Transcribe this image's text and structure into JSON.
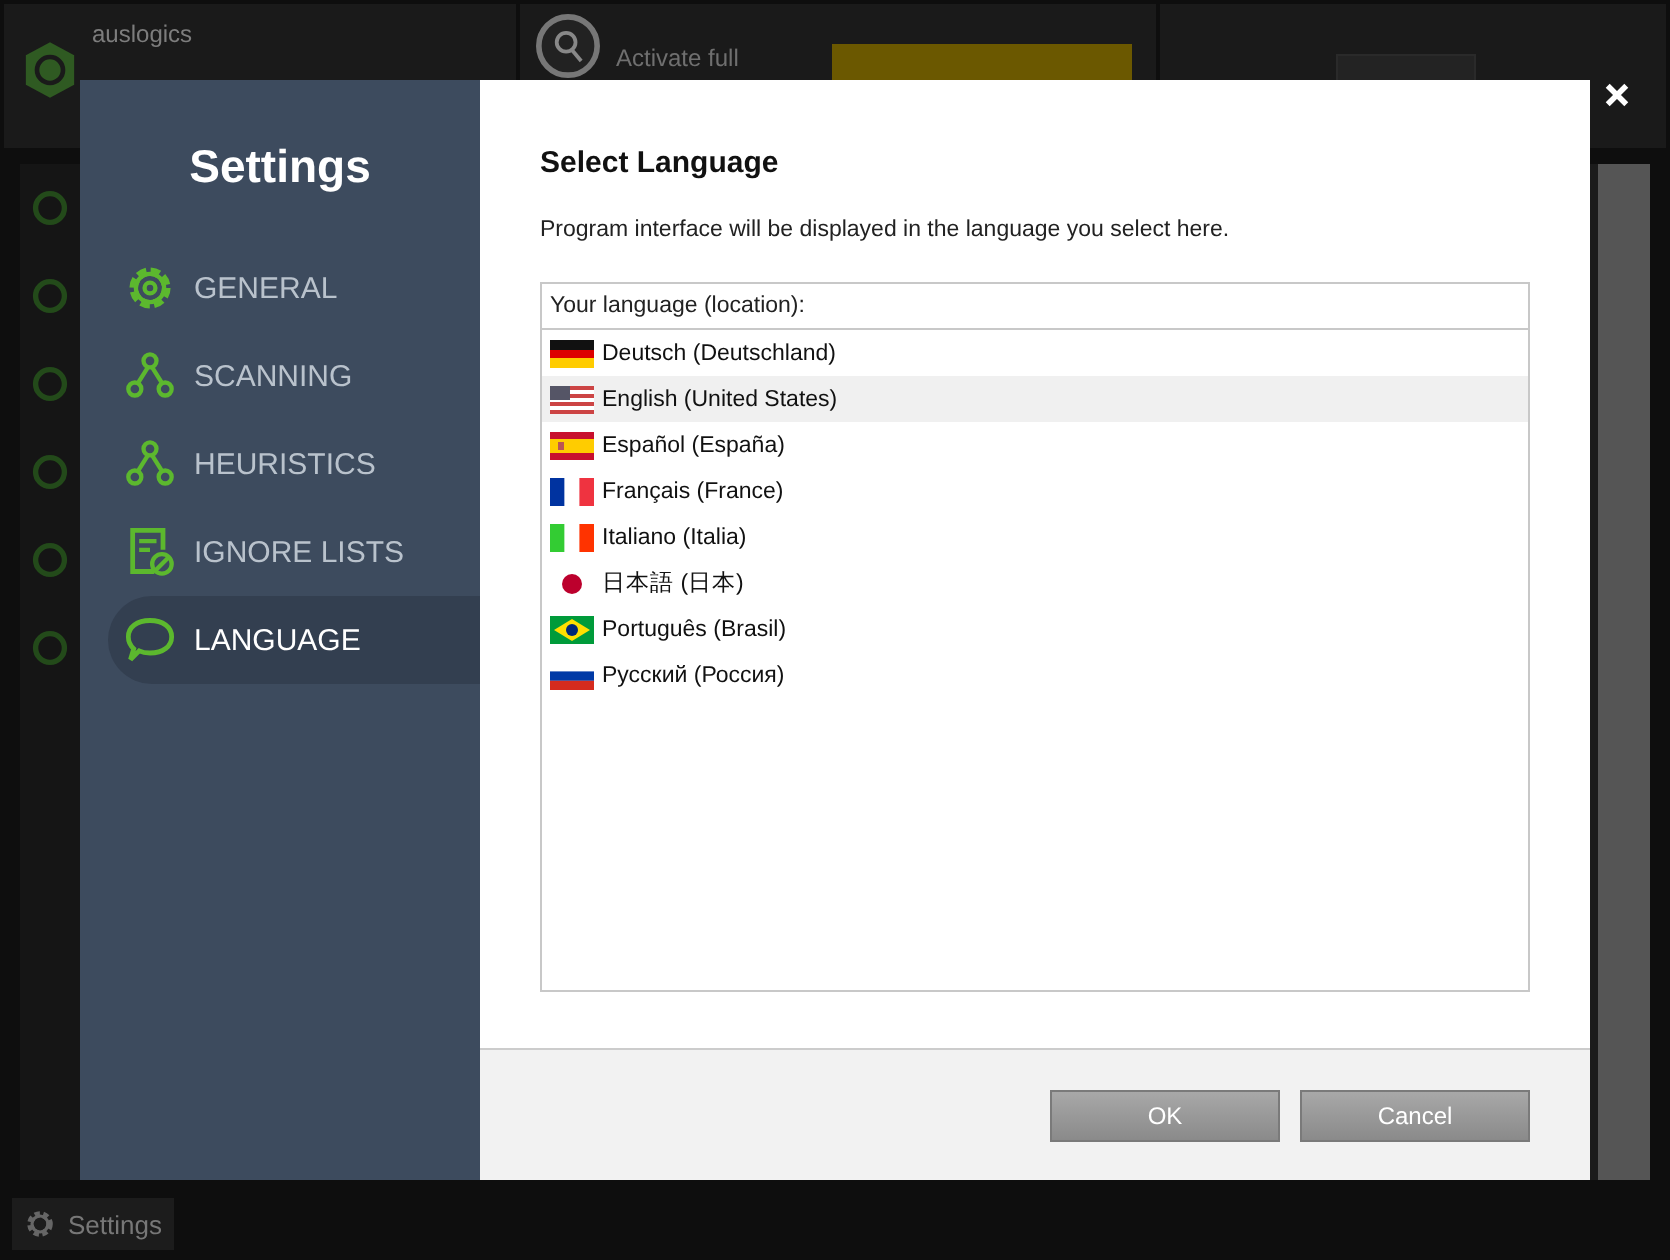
{
  "app": {
    "brand": "auslogics",
    "activate_text": "Activate full",
    "settings_button": "Settings"
  },
  "dialog": {
    "title": "Settings",
    "nav": [
      {
        "label": "GENERAL",
        "kind": "gear",
        "selected": false
      },
      {
        "label": "SCANNING",
        "kind": "nodes",
        "selected": false
      },
      {
        "label": "HEURISTICS",
        "kind": "nodes",
        "selected": false
      },
      {
        "label": "IGNORE LISTS",
        "kind": "list",
        "selected": false
      },
      {
        "label": "LANGUAGE",
        "kind": "chat",
        "selected": true
      }
    ],
    "heading": "Select Language",
    "description": "Program interface will be displayed in the language you select here.",
    "list_header": "Your language (location):",
    "languages": [
      {
        "label": "Deutsch (Deutschland)",
        "kind": "de",
        "selected": false
      },
      {
        "label": "English (United States)",
        "kind": "us",
        "selected": true
      },
      {
        "label": "Español (España)",
        "kind": "es",
        "selected": false
      },
      {
        "label": "Français (France)",
        "kind": "fr",
        "selected": false
      },
      {
        "label": "Italiano (Italia)",
        "kind": "it",
        "selected": false
      },
      {
        "label": "日本語 (日本)",
        "kind": "jp",
        "selected": false
      },
      {
        "label": "Português (Brasil)",
        "kind": "br",
        "selected": false
      },
      {
        "label": "Русский (Россия)",
        "kind": "ru",
        "selected": false
      }
    ],
    "buttons": [
      "OK",
      "Cancel"
    ]
  }
}
